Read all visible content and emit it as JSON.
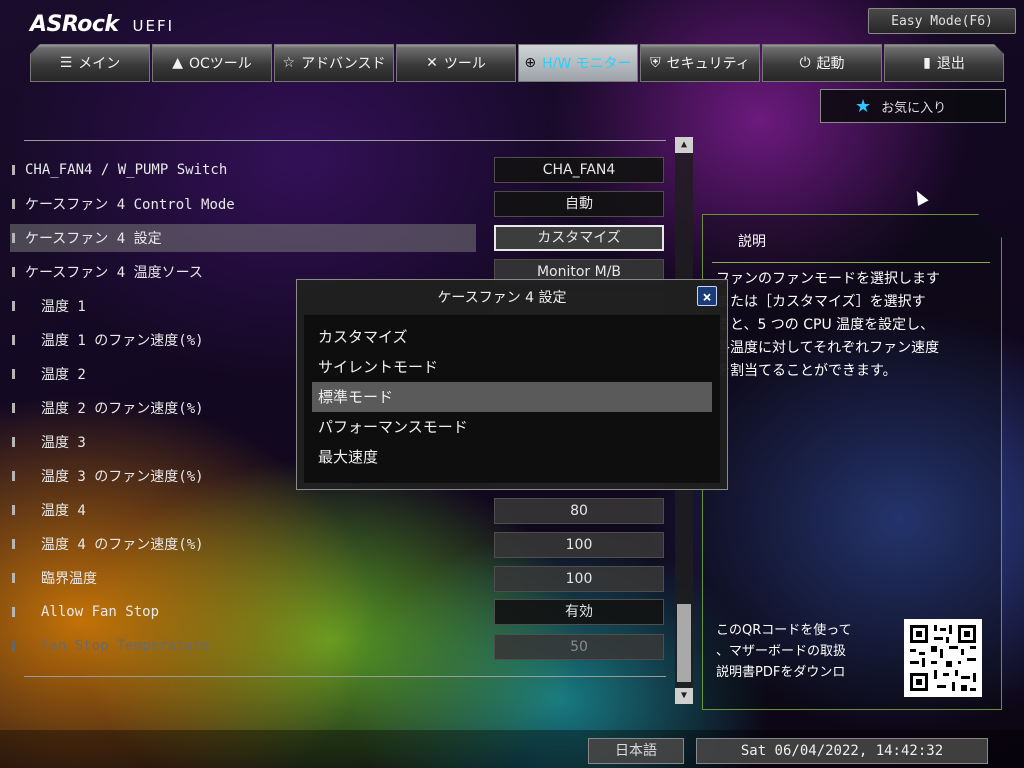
{
  "header": {
    "brand": "ASRock",
    "product": "UEFI",
    "easy_mode_label": "Easy Mode(F6)"
  },
  "tabs": [
    {
      "icon": "list-icon",
      "label": "メイン"
    },
    {
      "icon": "rocket-icon",
      "label": "OCツール"
    },
    {
      "icon": "star-outline-icon",
      "label": "アドバンスド"
    },
    {
      "icon": "tools-icon",
      "label": "ツール"
    },
    {
      "icon": "target-icon",
      "label": "H/W モニター",
      "active": true
    },
    {
      "icon": "shield-icon",
      "label": "セキュリティ"
    },
    {
      "icon": "power-icon",
      "label": "起動"
    },
    {
      "icon": "exit-door-icon",
      "label": "退出"
    }
  ],
  "favorites_label": "お気に入り",
  "settings": [
    {
      "label": "CHA_FAN4 / W_PUMP Switch",
      "value": "CHA_FAN4"
    },
    {
      "label": "ケースファン 4 Control Mode",
      "value": "自動"
    },
    {
      "label": "ケースファン 4 設定",
      "value": "カスタマイズ"
    },
    {
      "label": "ケースファン 4 温度ソース",
      "value": "Monitor M/B"
    },
    {
      "label": "温度 1",
      "value": ""
    },
    {
      "label": "温度 1 のファン速度(%)",
      "value": ""
    },
    {
      "label": "温度 2",
      "value": ""
    },
    {
      "label": "温度 2 のファン速度(%)",
      "value": ""
    },
    {
      "label": "温度 3",
      "value": ""
    },
    {
      "label": "温度 3 のファン速度(%)",
      "value": ""
    },
    {
      "label": "温度 4",
      "value": "80"
    },
    {
      "label": "温度 4 のファン速度(%)",
      "value": "100"
    },
    {
      "label": "臨界温度",
      "value": "100"
    },
    {
      "label": "Allow Fan Stop",
      "value": "有効"
    },
    {
      "label": "Fan Stop Temperature",
      "value": "50"
    }
  ],
  "popup": {
    "title": "ケースファン 4 設定",
    "close_label": "×",
    "options": [
      "カスタマイズ",
      "サイレントモード",
      "標準モード",
      "パフォーマンスモード",
      "最大速度"
    ],
    "highlighted": "標準モード"
  },
  "description": {
    "title": "説明",
    "text": "ファンのファンモードを選択します\nまたは［カスタマイズ］を選択す\nると、5 つの CPU 温度を設定し、\n各温度に対してそれぞれファン速度\nを割当てることができます。",
    "qr_text": "このQRコードを使って\n、マザーボードの取扱\n説明書PDFをダウンロ"
  },
  "footer": {
    "language": "日本語",
    "datetime": "Sat 06/04/2022, 14:42:32"
  }
}
